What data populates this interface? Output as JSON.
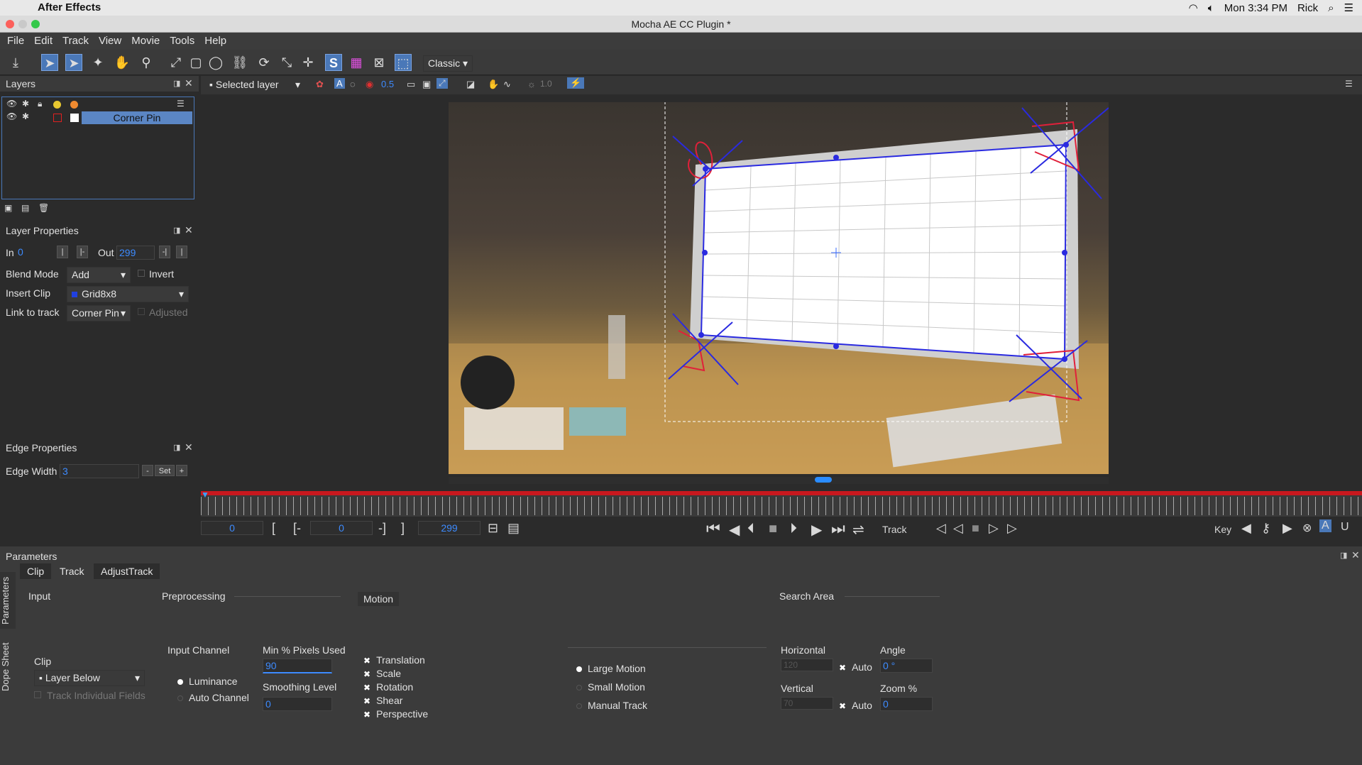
{
  "os_menubar": {
    "app": "After Effects",
    "clock": "Mon 3:34 PM",
    "user": "Rick"
  },
  "window": {
    "title": "Mocha AE CC Plugin *"
  },
  "menu": [
    "File",
    "Edit",
    "Track",
    "View",
    "Movie",
    "Tools",
    "Help"
  ],
  "toolbar": {
    "view_mode": "Classic"
  },
  "viewer_bar": {
    "layer_select": "Selected layer",
    "opacity": "0.5",
    "exposure": "1.0"
  },
  "layers": {
    "title": "Layers",
    "items": [
      {
        "name": "Corner Pin"
      }
    ]
  },
  "layer_properties": {
    "title": "Layer Properties",
    "in_label": "In",
    "in_value": "0",
    "out_label": "Out",
    "out_value": "299",
    "blend_label": "Blend Mode",
    "blend_value": "Add",
    "invert_label": "Invert",
    "insert_label": "Insert Clip",
    "insert_value": "Grid8x8",
    "link_label": "Link to track",
    "link_value": "Corner Pin",
    "adjusted_label": "Adjusted"
  },
  "edge_properties": {
    "title": "Edge Properties",
    "width_label": "Edge Width",
    "width_value": "3",
    "minus": "-",
    "set": "Set",
    "plus": "+"
  },
  "transport": {
    "current": "0",
    "in": "0",
    "out": "299",
    "bracket_open": "[",
    "bracket_in": "[-",
    "bracket_out": "-]",
    "bracket_close": "]",
    "track_label": "Track",
    "key_label": "Key"
  },
  "parameters": {
    "title": "Parameters",
    "tabs": [
      "Clip",
      "Track",
      "AdjustTrack"
    ],
    "side_tabs": [
      "Parameters",
      "Dope Sheet"
    ],
    "input_label": "Input",
    "preprocessing_label": "Preprocessing",
    "motion_label": "Motion",
    "search_area_label": "Search Area",
    "clip_label": "Clip",
    "clip_value": "Layer Below",
    "track_fields": "Track Individual Fields",
    "input_channel_label": "Input Channel",
    "luminance": "Luminance",
    "auto_channel": "Auto Channel",
    "min_pixels_label": "Min % Pixels Used",
    "min_pixels_value": "90",
    "smoothing_label": "Smoothing Level",
    "smoothing_value": "0",
    "motion_opts": [
      "Translation",
      "Scale",
      "Rotation",
      "Shear",
      "Perspective"
    ],
    "large_motion": "Large Motion",
    "small_motion": "Small Motion",
    "manual_track": "Manual Track",
    "horizontal_label": "Horizontal",
    "horizontal_value": "120",
    "vertical_label": "Vertical",
    "vertical_value": "70",
    "auto_label": "Auto",
    "angle_label": "Angle",
    "angle_value": "0 °",
    "zoom_label": "Zoom %",
    "zoom_value": "0"
  }
}
